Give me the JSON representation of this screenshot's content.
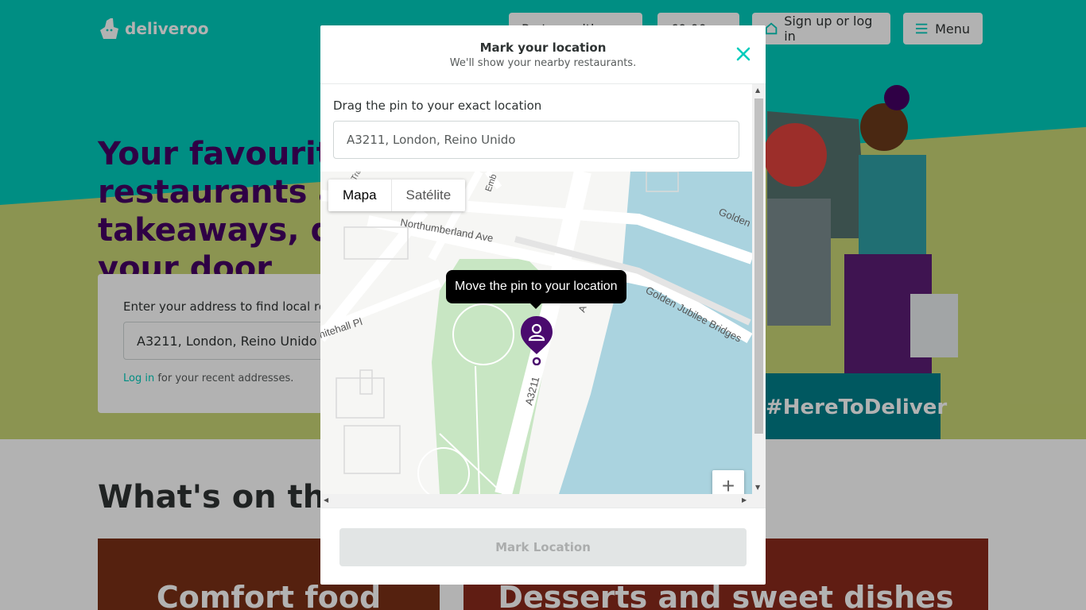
{
  "header": {
    "brand": "deliveroo",
    "btn_partial_1": "Partner with us",
    "btn_partial_2": "£0.00",
    "signup_label": "Sign up or log in",
    "menu_label": "Menu"
  },
  "hero": {
    "title": "Your favourite restaurants and takeaways, delivered to your door",
    "hashtag": "#HereToDeliver"
  },
  "search_card": {
    "label": "Enter your address to find local restaurants",
    "address_value": "A3211, London, Reino Unido",
    "login_link": "Log in",
    "login_suffix": " for your recent addresses."
  },
  "lower": {
    "title": "What's on the menu?",
    "categories": [
      "Comfort food",
      "Desserts and sweet dishes"
    ]
  },
  "modal": {
    "title": "Mark your location",
    "subtitle": "We'll show your nearby restaurants.",
    "drag_label": "Drag the pin to your exact location",
    "address_value": "A3211, London, Reino Unido",
    "tooltip": "Move the pin to your location",
    "map_type": {
      "map": "Mapa",
      "satellite": "Satélite"
    },
    "map_labels": {
      "northumberland": "Northumberland Ave",
      "golden_bridges": "Golden Jubilee Bridges",
      "golden": "Golden",
      "whitehall": "nitehall Pl",
      "a3211": "A3211",
      "embankment": "Emb",
      "a_partial": "A",
      "tra_partial": "Tra"
    },
    "zoom_in": "+",
    "mark_button": "Mark Location"
  },
  "colors": {
    "teal": "#00ccbc",
    "purple": "#440063",
    "pin": "#4a0a6e",
    "park": "#c8e6c3",
    "water": "#aad3df"
  }
}
